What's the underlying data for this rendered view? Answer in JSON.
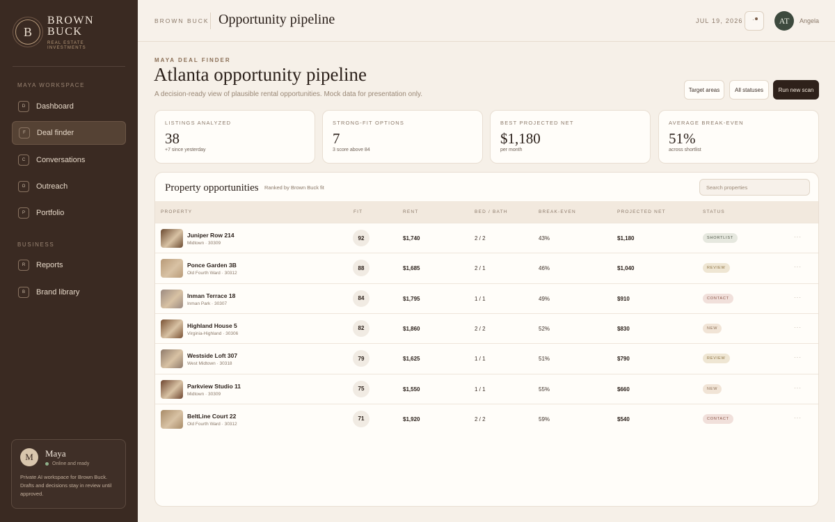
{
  "brand": {
    "mark": "B",
    "name_line1": "BROWN",
    "name_line2": "BUCK",
    "sub_line1": "REAL ESTATE",
    "sub_line2": "INVESTMENTS"
  },
  "sidebar": {
    "section_workspace": "MAYA WORKSPACE",
    "section_business": "BUSINESS",
    "items": [
      {
        "key": "D",
        "label": "Dashboard",
        "active": false
      },
      {
        "key": "F",
        "label": "Deal finder",
        "active": true
      },
      {
        "key": "C",
        "label": "Conversations",
        "active": false
      },
      {
        "key": "O",
        "label": "Outreach",
        "active": false
      },
      {
        "key": "P",
        "label": "Portfolio",
        "active": false
      },
      {
        "key": "R",
        "label": "Reports",
        "active": false
      },
      {
        "key": "B",
        "label": "Brand library",
        "active": false
      }
    ],
    "maya": {
      "initial": "M",
      "name": "Maya",
      "status": "Online and ready",
      "description": "Private AI workspace for Brown Buck. Drafts and decisions stay in review until approved."
    }
  },
  "topbar": {
    "brand": "BROWN BUCK",
    "title": "Opportunity pipeline",
    "date": "JUL 19, 2026",
    "avatar_initials": "AT",
    "user_name": "Angela"
  },
  "header": {
    "eyebrow": "MAYA DEAL FINDER",
    "title": "Atlanta opportunity pipeline",
    "subtitle": "A decision-ready view of plausible rental opportunities. Mock data for presentation only.",
    "buttons": {
      "target_areas": "Target areas",
      "all_statuses": "All statuses",
      "run_scan": "Run new scan"
    }
  },
  "kpis": [
    {
      "label": "LISTINGS ANALYZED",
      "value": "38",
      "note": "+7 since yesterday"
    },
    {
      "label": "STRONG-FIT OPTIONS",
      "value": "7",
      "note": "3 score above 84"
    },
    {
      "label": "BEST PROJECTED NET",
      "value": "$1,180",
      "note": "per month"
    },
    {
      "label": "AVERAGE BREAK-EVEN",
      "value": "51%",
      "note": "across shortlist"
    }
  ],
  "table": {
    "title": "Property opportunities",
    "subtitle": "Ranked by Brown Buck fit",
    "search_placeholder": "Search properties",
    "columns": [
      "PROPERTY",
      "FIT",
      "RENT",
      "BED / BATH",
      "BREAK-EVEN",
      "PROJECTED NET",
      "STATUS"
    ],
    "rows": [
      {
        "name": "Juniper Row 214",
        "location": "Midtown · 30309",
        "fit": "92",
        "rent": "$1,740",
        "bedbath": "2 / 2",
        "breakeven": "43%",
        "net": "$1,180",
        "status": "SHORTLIST"
      },
      {
        "name": "Ponce Garden 3B",
        "location": "Old Fourth Ward · 30312",
        "fit": "88",
        "rent": "$1,685",
        "bedbath": "2 / 1",
        "breakeven": "46%",
        "net": "$1,040",
        "status": "REVIEW"
      },
      {
        "name": "Inman Terrace 18",
        "location": "Inman Park · 30307",
        "fit": "84",
        "rent": "$1,795",
        "bedbath": "1 / 1",
        "breakeven": "49%",
        "net": "$910",
        "status": "CONTACT"
      },
      {
        "name": "Highland House 5",
        "location": "Virginia-Highland · 30306",
        "fit": "82",
        "rent": "$1,860",
        "bedbath": "2 / 2",
        "breakeven": "52%",
        "net": "$830",
        "status": "NEW"
      },
      {
        "name": "Westside Loft 307",
        "location": "West Midtown · 30318",
        "fit": "79",
        "rent": "$1,625",
        "bedbath": "1 / 1",
        "breakeven": "51%",
        "net": "$790",
        "status": "REVIEW"
      },
      {
        "name": "Parkview Studio 11",
        "location": "Midtown · 30309",
        "fit": "75",
        "rent": "$1,550",
        "bedbath": "1 / 1",
        "breakeven": "55%",
        "net": "$660",
        "status": "NEW"
      },
      {
        "name": "BeltLine Court 22",
        "location": "Old Fourth Ward · 30312",
        "fit": "71",
        "rent": "$1,920",
        "bedbath": "2 / 2",
        "breakeven": "59%",
        "net": "$540",
        "status": "CONTACT"
      }
    ],
    "more_glyph": "···"
  },
  "status_colors": {
    "SHORTLIST": {
      "bg": "#e6e8df",
      "fg": "#4a5344"
    },
    "REVIEW": {
      "bg": "#efe6d3",
      "fg": "#8a7040"
    },
    "CONTACT": {
      "bg": "#f1e0db",
      "fg": "#8a5648"
    },
    "NEW": {
      "bg": "#f1e4d6",
      "fg": "#8a6e55"
    }
  },
  "thumb_colors": [
    "#6b4a30",
    "#b89a78",
    "#9c8a80",
    "#7a5234",
    "#8f7a6a",
    "#6e4630",
    "#a88b68"
  ],
  "icons": {
    "bell": "bell-icon",
    "search": "search-icon",
    "more": "more-icon"
  }
}
